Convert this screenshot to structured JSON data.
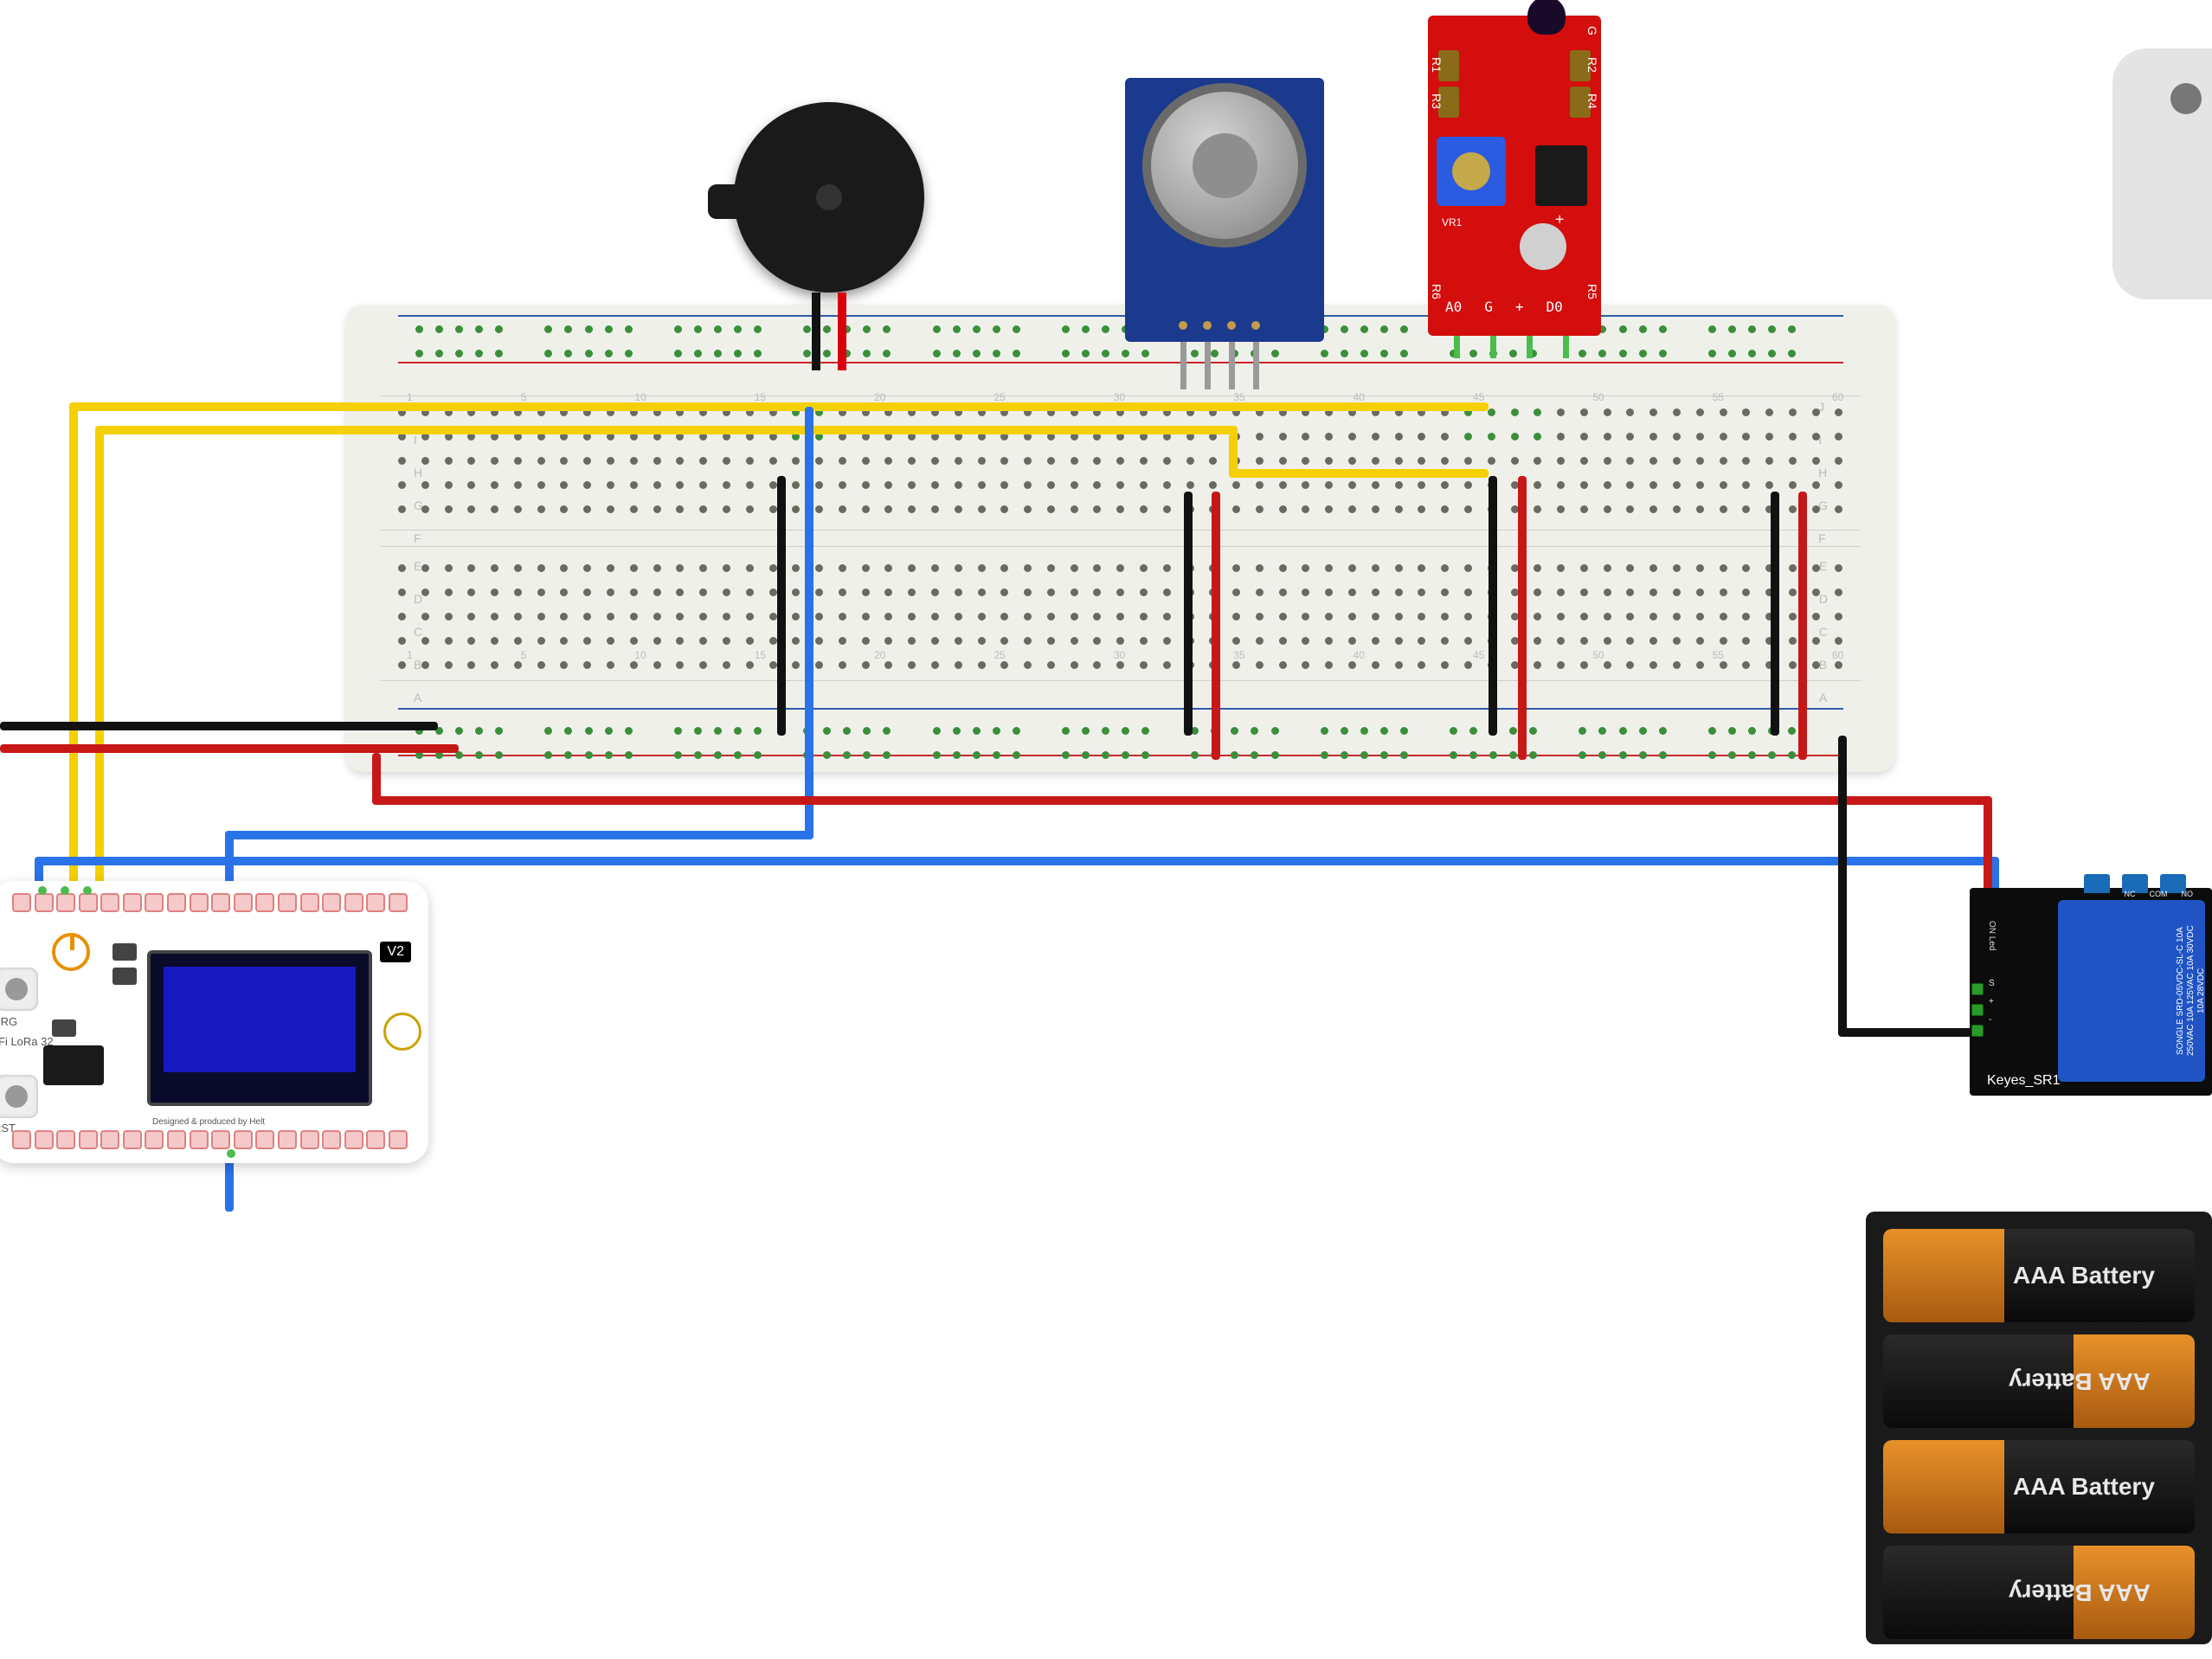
{
  "breadboard": {
    "top_letters": [
      "F",
      "G",
      "H",
      "I",
      "J"
    ],
    "bottom_letters": [
      "A",
      "B",
      "C",
      "D",
      "E"
    ],
    "col_numbers": [
      1,
      5,
      10,
      15,
      20,
      25,
      30,
      35,
      40,
      45,
      50,
      55,
      60
    ]
  },
  "buzzer": {
    "name": "Piezo Buzzer"
  },
  "gas_sensor": {
    "name": "MQ Gas Sensor"
  },
  "flame_sensor": {
    "name": "KY-026 Flame Sensor",
    "side_r1": "R1",
    "side_r2": "R2",
    "side_r3": "R3",
    "side_r4": "R4",
    "side_r5": "R5",
    "side_r6": "R6",
    "side_g": "G",
    "side_plus": "+",
    "vr_label": "VR1",
    "pin_labels": [
      "A0",
      "G",
      "+",
      "D0"
    ]
  },
  "heltec": {
    "product": "Fi LoRa 32",
    "version": "V2",
    "btn_prog": "PRG",
    "btn_reset": "RST",
    "footer": "Designed & produced by Helt"
  },
  "relay": {
    "brand": "Keyes_SR1",
    "body_text": "SONGLE SRD-05VDC-SL-C 10A 250VAC 10A 125VAC 10A 30VDC 10A 28VDC",
    "pin_s": "S",
    "pin_plus": "+",
    "pin_minus": "-",
    "top_nc": "NC",
    "top_com": "COM",
    "top_no": "NO",
    "led_label": "ON Led"
  },
  "battery": {
    "cell_label": "AAA Battery"
  }
}
